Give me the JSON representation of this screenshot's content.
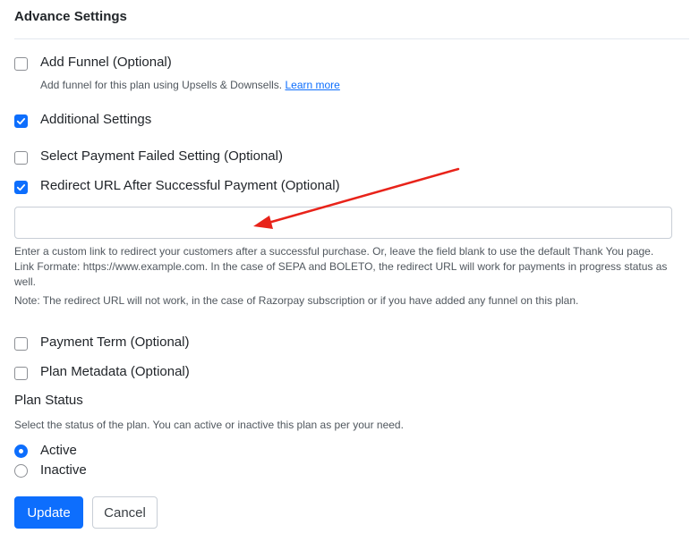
{
  "section": {
    "title": "Advance Settings"
  },
  "options": {
    "add_funnel": {
      "label": "Add Funnel (Optional)",
      "checked": false,
      "help": "Add funnel for this plan using Upsells & Downsells.",
      "learn_more": "Learn more"
    },
    "additional_settings": {
      "label": "Additional Settings",
      "checked": true
    },
    "payment_failed": {
      "label": "Select Payment Failed Setting (Optional)",
      "checked": false
    },
    "redirect_url": {
      "label": "Redirect URL After Successful Payment (Optional)",
      "checked": true,
      "value": "",
      "placeholder": ""
    },
    "payment_term": {
      "label": "Payment Term (Optional)",
      "checked": false
    },
    "plan_metadata": {
      "label": "Plan Metadata (Optional)",
      "checked": false
    }
  },
  "redirect_desc": {
    "line1": "Enter a custom link to redirect your customers after a successful purchase. Or, leave the field blank to use the default Thank You page.",
    "line2": "Link Formate: https://www.example.com. In the case of SEPA and BOLETO, the redirect URL will work for payments in progress status as well.",
    "note": "Note: The redirect URL will not work, in the case of Razorpay subscription or if you have added any funnel on this plan."
  },
  "plan_status": {
    "title": "Plan Status",
    "help": "Select the status of the plan. You can active or inactive this plan as per your need.",
    "options": [
      {
        "label": "Active",
        "selected": true
      },
      {
        "label": "Inactive",
        "selected": false
      }
    ]
  },
  "buttons": {
    "update": "Update",
    "cancel": "Cancel"
  },
  "colors": {
    "accent": "#0d6efd",
    "annotation": "#e8231a"
  }
}
